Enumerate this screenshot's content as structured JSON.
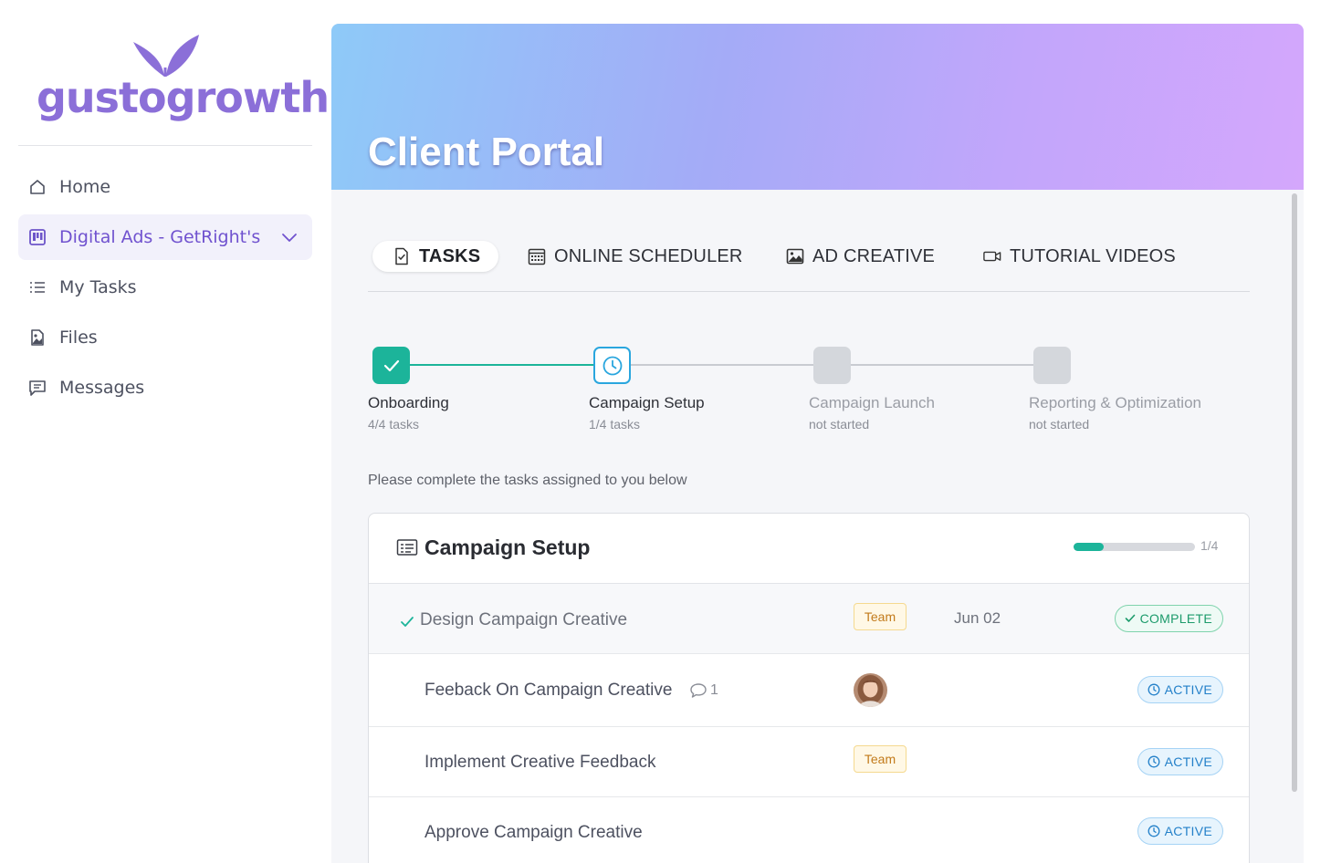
{
  "brand": {
    "logo_text": "gustogrowth",
    "logo_color": "#8b6fd8"
  },
  "sidebar": {
    "items": [
      {
        "label": "Home",
        "icon": "home-icon"
      },
      {
        "label": "Digital Ads - GetRight's",
        "icon": "project-board-icon",
        "active": true
      },
      {
        "label": "My Tasks",
        "icon": "list-icon"
      },
      {
        "label": "Files",
        "icon": "file-image-icon"
      },
      {
        "label": "Messages",
        "icon": "message-icon"
      }
    ]
  },
  "banner": {
    "title": "Client Portal"
  },
  "tabs": [
    {
      "label": "TASKS",
      "icon": "task-file-icon",
      "active": true
    },
    {
      "label": "ONLINE SCHEDULER",
      "icon": "calendar-icon"
    },
    {
      "label": "AD CREATIVE",
      "icon": "image-icon"
    },
    {
      "label": "TUTORIAL VIDEOS",
      "icon": "video-camera-icon"
    }
  ],
  "steps": [
    {
      "name": "Onboarding",
      "sub": "4/4 tasks",
      "state": "complete"
    },
    {
      "name": "Campaign Setup",
      "sub": "1/4 tasks",
      "state": "in-progress"
    },
    {
      "name": "Campaign Launch",
      "sub": "not started",
      "state": "not-started"
    },
    {
      "name": "Reporting & Optimization",
      "sub": "not started",
      "state": "not-started"
    }
  ],
  "instructions": "Please complete the tasks assigned to you below",
  "task_group": {
    "title": "Campaign Setup",
    "progress_text": "1/4",
    "progress_fraction": 0.25,
    "tasks": [
      {
        "name": "Design Campaign Creative",
        "assignee": "Team",
        "date": "Jun 02",
        "status": "COMPLETE",
        "done": true
      },
      {
        "name": "Feeback On Campaign Creative",
        "comments": "1",
        "assignee_avatar": true,
        "status": "ACTIVE"
      },
      {
        "name": "Implement Creative Feedback",
        "assignee": "Team",
        "status": "ACTIVE"
      },
      {
        "name": "Approve Campaign Creative",
        "status": "ACTIVE"
      }
    ]
  },
  "colors": {
    "accent": "#7052cf",
    "teal": "#1cb49a",
    "active_blue": "#2380c9",
    "team_orange": "#c27a1a"
  }
}
